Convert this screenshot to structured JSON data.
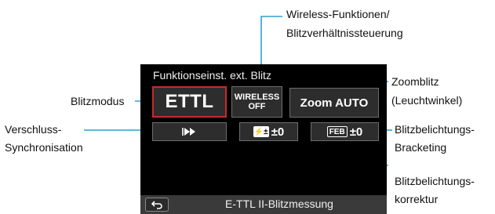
{
  "screen": {
    "title": "Funktionseinst. ext. Blitz",
    "tiles": {
      "mode": "ETTL",
      "wireless_line1": "WIRELESS",
      "wireless_line2": "OFF",
      "zoom": "Zoom AUTO",
      "sync_icon": "high-speed-sync-icon",
      "fec_icon_label": "FEC",
      "fec_value": "±0",
      "feb_icon_label": "FEB",
      "feb_value": "±0"
    },
    "bottom_bar": {
      "back_icon": "back-arrow-icon",
      "label": "E-TTL II-Blitzmessung"
    }
  },
  "callouts": {
    "wireless_1": "Wireless-Funktionen/",
    "wireless_2": "Blitzverhältnissteuerung",
    "zoom_1": "Zoomblitz",
    "zoom_2": "(Leuchtwinkel)",
    "mode": "Blitzmodus",
    "sync_1": "Verschluss-",
    "sync_2": "Synchronisation",
    "feb_1": "Blitzbelichtungs-",
    "feb_2": "Bracketing",
    "fec_1": "Blitzbelichtungs-",
    "fec_2": "korrektur"
  },
  "colors": {
    "callout_line": "#2f9fd0",
    "selection": "#c92a2a",
    "screen_bg": "#000000",
    "tile_bg": "#2d2d2d"
  }
}
